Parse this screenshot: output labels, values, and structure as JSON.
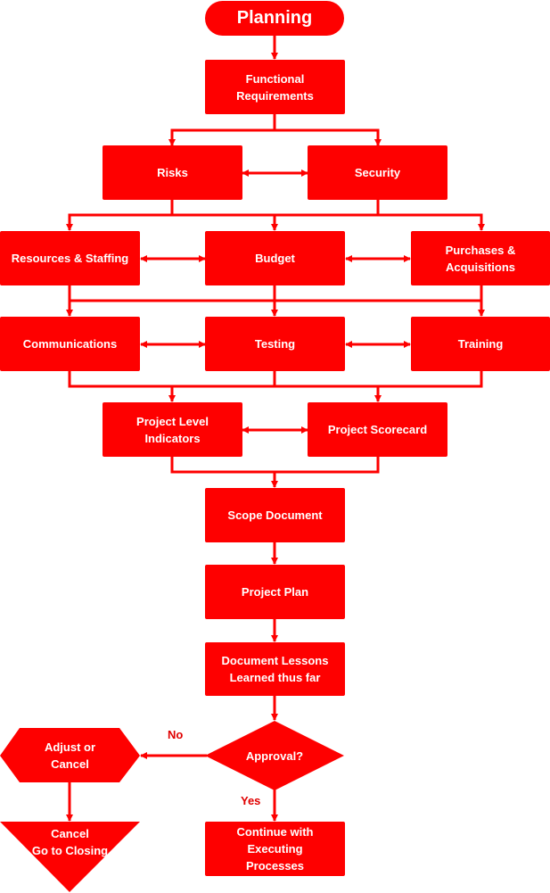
{
  "diagram": {
    "colors": {
      "node_fill": "#fe0000",
      "text": "#ffffff",
      "line": "#fe0000",
      "label": "#e00000"
    },
    "nodes": {
      "start": "Planning",
      "functional": "Functional\nRequirements",
      "risks": "Risks",
      "security": "Security",
      "resources": "Resources & Staffing",
      "budget": "Budget",
      "purchases": "Purchases &\nAcquisitions",
      "communications": "Communications",
      "testing": "Testing",
      "training": "Training",
      "pli": "Project Level\nIndicators",
      "scorecard": "Project Scorecard",
      "scope": "Scope Document",
      "plan": "Project Plan",
      "lessons": "Document Lessons\nLearned thus far",
      "approval": "Approval?",
      "adjust": "Adjust or\nCancel",
      "cancel": "Cancel\nGo to Closing",
      "continue": "Continue with\nExecuting\nProcesses"
    },
    "edge_labels": {
      "no": "No",
      "yes": "Yes"
    }
  }
}
